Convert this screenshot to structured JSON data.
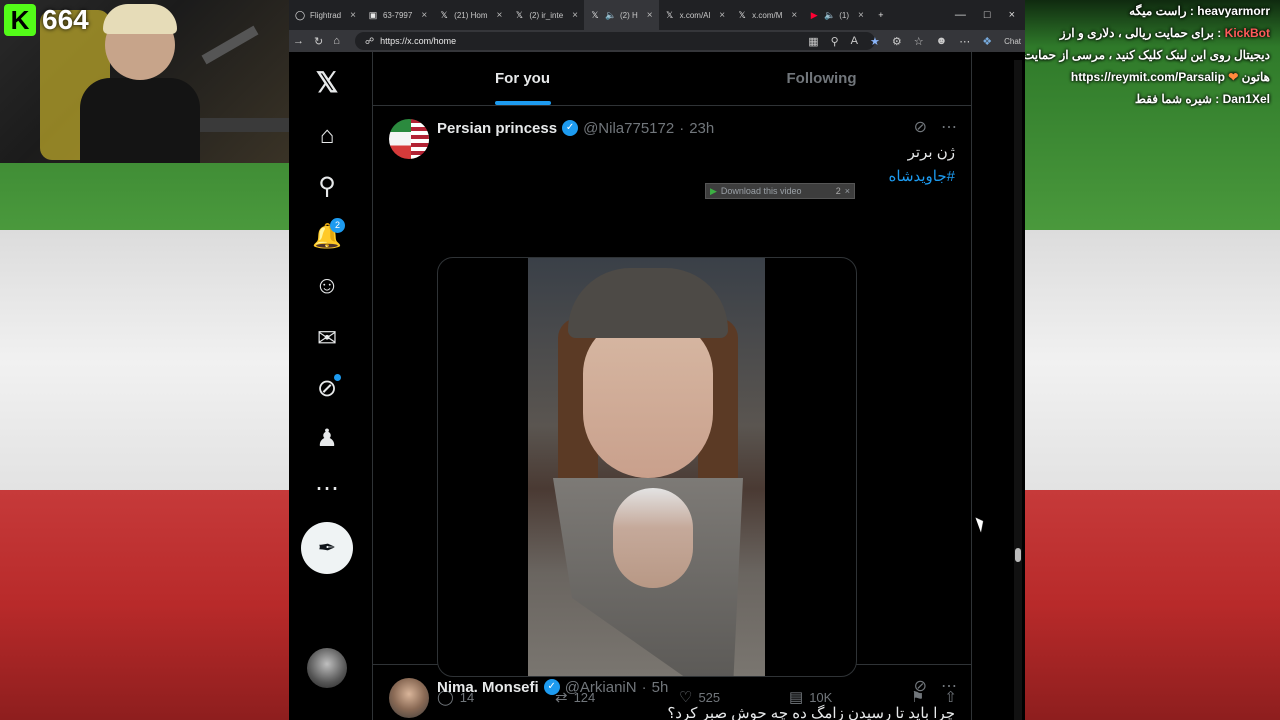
{
  "stream": {
    "platform_count": "664",
    "kick_logo": "K",
    "chat": [
      {
        "user": "heavyarmorr",
        "text": "راست میگه :"
      },
      {
        "user": "KickBot",
        "text": "برای حمایت ریالی ، دلاری و ارز :"
      },
      {
        "user": "",
        "text": "دیجیتال روی این لینک کلیک کنید ، مرسی از حمایت"
      },
      {
        "user": "",
        "text": "هاتون",
        "link": "https://reymit.com/Parsalip"
      },
      {
        "user": "Dan1Xel",
        "text": "شیره شما فقط :"
      }
    ]
  },
  "browser": {
    "tabs": [
      {
        "icon": "globe-icon",
        "label": "Flightrad"
      },
      {
        "icon": "doc-icon",
        "label": "63-7997"
      },
      {
        "icon": "x-icon",
        "label": "(21) Hom"
      },
      {
        "icon": "x-icon",
        "label": "(2) ir_inte"
      },
      {
        "icon": "x-icon",
        "label": "(2) H",
        "active": true
      },
      {
        "icon": "x-icon",
        "label": "x.com/Al"
      },
      {
        "icon": "x-icon",
        "label": "x.com/M"
      },
      {
        "icon": "youtube-icon",
        "label": "(1)"
      }
    ],
    "url": "https://x.com/home",
    "side_label": "Chat"
  },
  "x": {
    "tabs": [
      {
        "label": "For you",
        "active": true
      },
      {
        "label": "Following",
        "active": false
      }
    ],
    "notifications_badge": "2",
    "tweets": [
      {
        "name": "Persian princess",
        "handle": "@Nila775172",
        "time": "23h",
        "line1": "ژن برتر",
        "hashtag": "#جاویدشاه",
        "download_label": "Download this video",
        "download_count": "2",
        "replies": "14",
        "reposts": "124",
        "likes": "525",
        "views": "10K"
      },
      {
        "name": "Nima. Monsefi",
        "handle": "@ArkianiN",
        "time": "5h",
        "line1": "چرا باید تا رسیدن زامگ ده چه حوش صبر کرد؟"
      }
    ]
  },
  "colors": {
    "accent": "#1d9bf0",
    "kick_green": "#53fc18"
  }
}
